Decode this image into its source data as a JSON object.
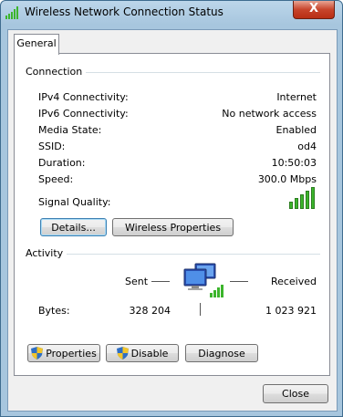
{
  "window": {
    "title": "Wireless Network Connection Status",
    "close_glyph": "X"
  },
  "tabs": {
    "general": "General"
  },
  "connection": {
    "label": "Connection",
    "rows": [
      {
        "label": "IPv4 Connectivity:",
        "value": "Internet"
      },
      {
        "label": "IPv6 Connectivity:",
        "value": "No network access"
      },
      {
        "label": "Media State:",
        "value": "Enabled"
      },
      {
        "label": "SSID:",
        "value": "od4"
      },
      {
        "label": "Duration:",
        "value": "10:50:03"
      },
      {
        "label": "Speed:",
        "value": "300.0 Mbps"
      }
    ],
    "signal_quality_label": "Signal Quality:",
    "signal_bars_filled": 5,
    "details_button": "Details...",
    "wireless_properties_button": "Wireless Properties"
  },
  "activity": {
    "label": "Activity",
    "sent_label": "Sent",
    "received_label": "Received",
    "bytes_label": "Bytes:",
    "bytes_sent": "328 204",
    "bytes_received": "1 023 921",
    "properties_button": "Properties",
    "disable_button": "Disable",
    "diagnose_button": "Diagnose"
  },
  "footer": {
    "close_button": "Close"
  },
  "colors": {
    "signal": "#3cb52c",
    "shield_blue": "#2f6fc4",
    "shield_yellow": "#f2c52b"
  }
}
